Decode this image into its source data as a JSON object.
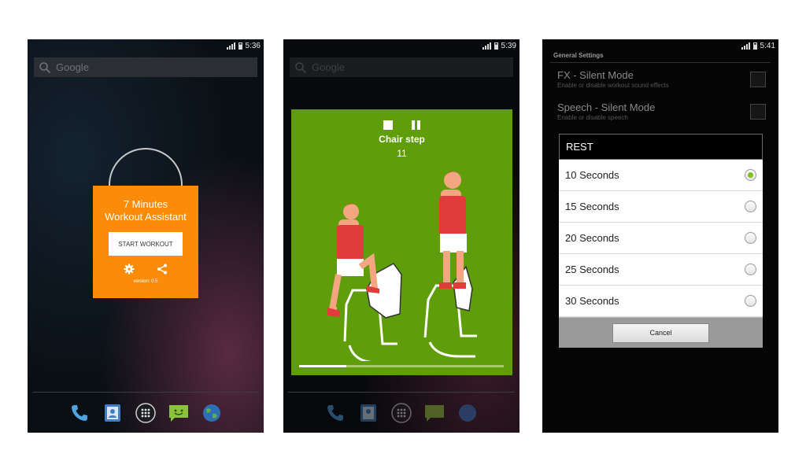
{
  "screens": [
    {
      "status_time": "5:36",
      "search_text": "Google",
      "widget": {
        "title_line1": "7 Minutes",
        "title_line2": "Workout Assistant",
        "start_button": "START WORKOUT",
        "version": "version: 0.5"
      },
      "dock_icons": [
        "phone-icon",
        "contacts-icon",
        "apps-icon",
        "messaging-icon",
        "browser-icon"
      ]
    },
    {
      "status_time": "5:39",
      "search_text": "Google",
      "workout": {
        "exercise": "Chair step",
        "count": "11",
        "progress": 0.23,
        "card_color": "#5f9e0a"
      }
    },
    {
      "status_time": "5:41",
      "settings": {
        "section": "General Settings",
        "prefs": [
          {
            "title": "FX - Silent Mode",
            "summary": "Enable or disable workout sound effects"
          },
          {
            "title": "Speech - Silent Mode",
            "summary": "Enable or disable speech"
          }
        ]
      },
      "dialog": {
        "title": "REST",
        "options": [
          "10 Seconds",
          "15 Seconds",
          "20 Seconds",
          "25 Seconds",
          "30 Seconds"
        ],
        "selected_index": 0,
        "cancel": "Cancel"
      }
    }
  ],
  "colors": {
    "widget_orange": "#fb8b08",
    "radio_selected": "#7bc11f"
  }
}
